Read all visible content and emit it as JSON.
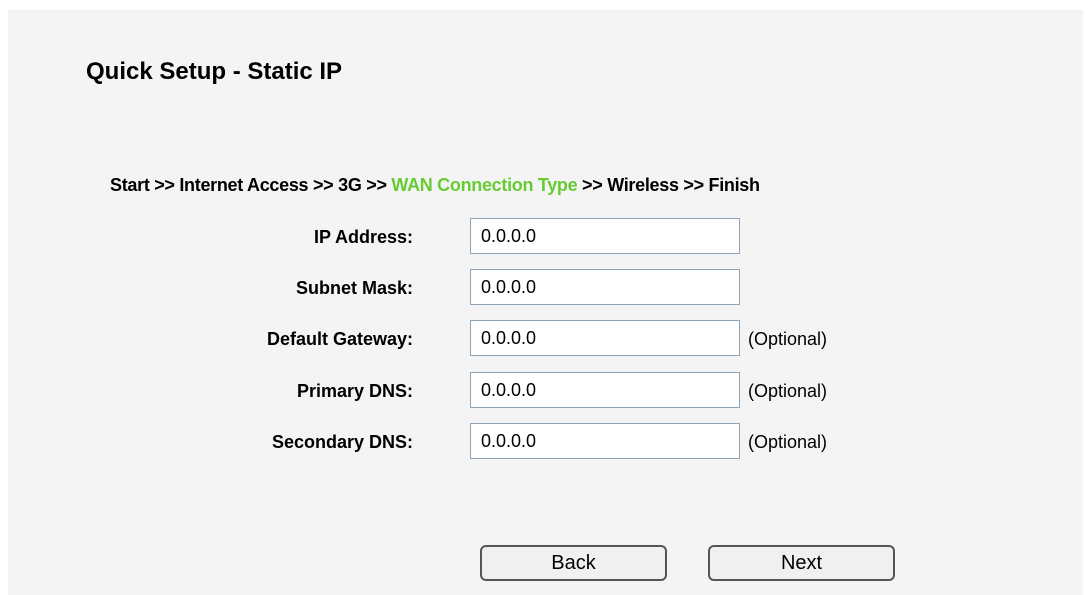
{
  "page": {
    "title": "Quick Setup - Static IP"
  },
  "breadcrumb": {
    "steps": [
      "Start",
      "Internet Access",
      "3G",
      "WAN Connection Type",
      "Wireless",
      "Finish"
    ],
    "separator": ">>",
    "active_step": "WAN Connection Type",
    "active_color": "#66cc33"
  },
  "form": {
    "ip_address": {
      "label": "IP Address:",
      "value": "0.0.0.0",
      "note": ""
    },
    "subnet_mask": {
      "label": "Subnet Mask:",
      "value": "0.0.0.0",
      "note": ""
    },
    "default_gateway": {
      "label": "Default Gateway:",
      "value": "0.0.0.0",
      "note": "(Optional)"
    },
    "primary_dns": {
      "label": "Primary DNS:",
      "value": "0.0.0.0",
      "note": "(Optional)"
    },
    "secondary_dns": {
      "label": "Secondary DNS:",
      "value": "0.0.0.0",
      "note": "(Optional)"
    }
  },
  "buttons": {
    "back": "Back",
    "next": "Next"
  }
}
